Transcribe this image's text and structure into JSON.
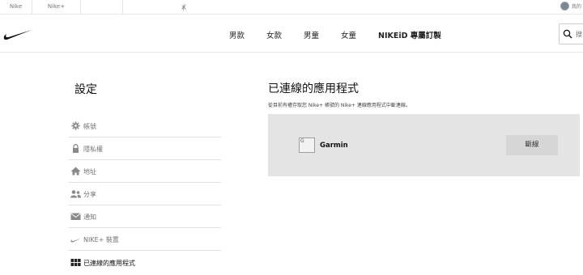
{
  "topbar": {
    "tabs": [
      "Nike",
      "Nike+"
    ],
    "user_label": "我的"
  },
  "nav": {
    "items": [
      "男款",
      "女款",
      "男童",
      "女童"
    ],
    "nikeid": "NIKEiD 專屬訂製",
    "search_placeholder": "搜"
  },
  "sidebar": {
    "title": "設定",
    "items": [
      {
        "label": "帳號",
        "icon": "gear-icon"
      },
      {
        "label": "隱私權",
        "icon": "lock-icon"
      },
      {
        "label": "地址",
        "icon": "home-icon"
      },
      {
        "label": "分享",
        "icon": "people-icon"
      },
      {
        "label": "通知",
        "icon": "envelope-icon"
      },
      {
        "label": "NIKE+ 裝置",
        "icon": "swoosh-icon"
      },
      {
        "label": "已連線的應用程式",
        "icon": "grid-icon"
      }
    ]
  },
  "main": {
    "title": "已連線的應用程式",
    "subtitle": "從目前有權存取您 Nike+ 帳號的 Nike+ 連線應用程式中斷連線。",
    "app": {
      "logo_alt": "G",
      "name": "Garmin",
      "button_label": "斷線"
    }
  }
}
